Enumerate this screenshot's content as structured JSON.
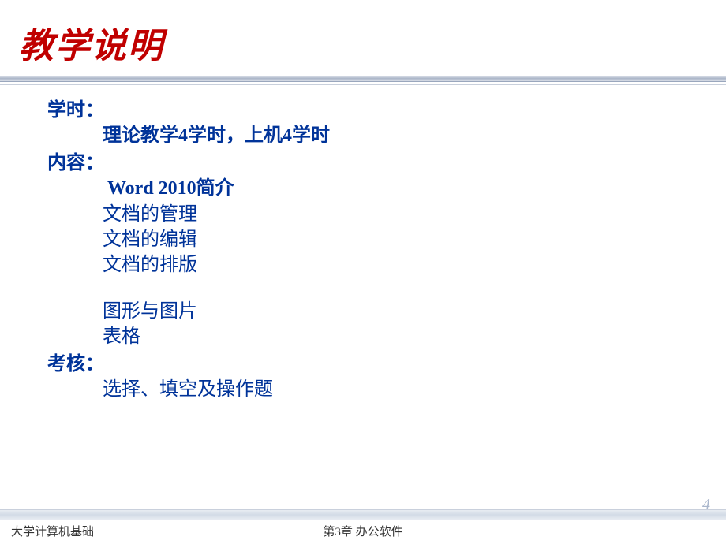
{
  "title": "教学说明",
  "sections": {
    "hours": {
      "label": "学时：",
      "detail": "理论教学4学时，上机4学时"
    },
    "content": {
      "label": "内容：",
      "items": [
        "Word 2010简介",
        "文档的管理",
        "文档的编辑",
        "文档的排版",
        "图形与图片",
        "表格"
      ]
    },
    "assessment": {
      "label": "考核：",
      "detail": "选择、填空及操作题"
    }
  },
  "footer": {
    "left": "大学计算机基础",
    "center": "第3章  办公软件",
    "page": "4"
  }
}
